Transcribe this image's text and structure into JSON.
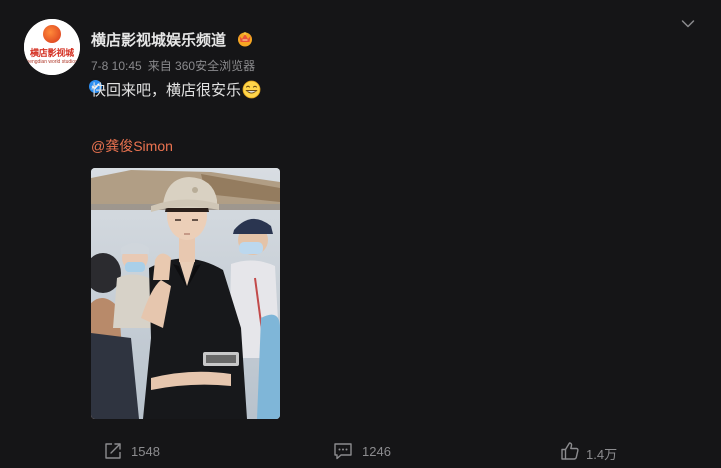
{
  "post": {
    "author": {
      "name": "横店影视城娱乐频道",
      "avatar_text": "横店影视城",
      "avatar_subtext": "hengdian world studios",
      "verified": true
    },
    "meta": {
      "time": "7-8 10:45",
      "source": "来自 360安全浏览器"
    },
    "text": "快回来吧，横店很安乐",
    "mention": "@龚俊Simon",
    "actions": {
      "repost_count": "1548",
      "comment_count": "1246",
      "like_count": "1.4万"
    }
  },
  "colors": {
    "background": "#151517",
    "mention": "#eb7350",
    "verified": "#2d8ff2",
    "muted": "#8a8a8d"
  },
  "icons": [
    "chevron-down-icon",
    "vip-crown-icon",
    "verified-icon",
    "smile-emoji-icon",
    "repost-icon",
    "comment-icon",
    "like-icon"
  ]
}
